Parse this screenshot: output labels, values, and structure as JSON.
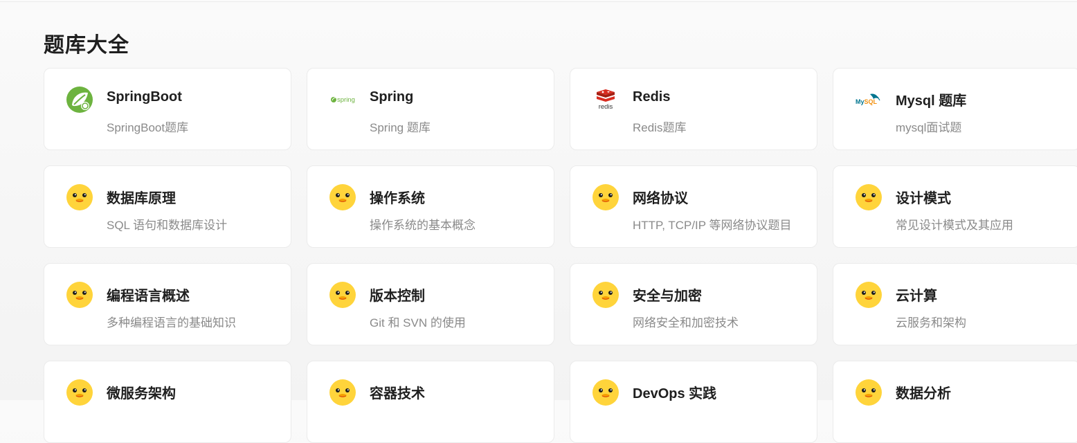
{
  "page": {
    "title": "题库大全"
  },
  "cards": [
    {
      "title": "SpringBoot",
      "desc": "SpringBoot题库",
      "icon": "springboot-logo-icon"
    },
    {
      "title": "Spring",
      "desc": "Spring 题库",
      "icon": "spring-logo-icon",
      "icon_text": "spring"
    },
    {
      "title": "Redis",
      "desc": "Redis题库",
      "icon": "redis-logo-icon",
      "icon_text": "redis"
    },
    {
      "title": "Mysql 题库",
      "desc": "mysql面试题",
      "icon": "mysql-logo-icon",
      "icon_text": "MySQL"
    },
    {
      "title": "数据库原理",
      "desc": "SQL 语句和数据库设计",
      "icon": "duck-icon"
    },
    {
      "title": "操作系统",
      "desc": "操作系统的基本概念",
      "icon": "duck-icon"
    },
    {
      "title": "网络协议",
      "desc": "HTTP, TCP/IP 等网络协议题目",
      "icon": "duck-icon"
    },
    {
      "title": "设计模式",
      "desc": "常见设计模式及其应用",
      "icon": "duck-icon"
    },
    {
      "title": "编程语言概述",
      "desc": "多种编程语言的基础知识",
      "icon": "duck-icon"
    },
    {
      "title": "版本控制",
      "desc": "Git 和 SVN 的使用",
      "icon": "duck-icon"
    },
    {
      "title": "安全与加密",
      "desc": "网络安全和加密技术",
      "icon": "duck-icon"
    },
    {
      "title": "云计算",
      "desc": "云服务和架构",
      "icon": "duck-icon"
    },
    {
      "title": "微服务架构",
      "desc": "",
      "icon": "duck-icon"
    },
    {
      "title": "容器技术",
      "desc": "",
      "icon": "duck-icon"
    },
    {
      "title": "DevOps 实践",
      "desc": "",
      "icon": "duck-icon"
    },
    {
      "title": "数据分析",
      "desc": "",
      "icon": "duck-icon"
    }
  ],
  "colors": {
    "spring_green": "#6db33f",
    "redis_red": "#d82c20",
    "mysql_blue": "#00758f",
    "mysql_orange": "#f29111",
    "duck_yellow": "#ffd43b",
    "duck_beak": "#f59f00"
  }
}
